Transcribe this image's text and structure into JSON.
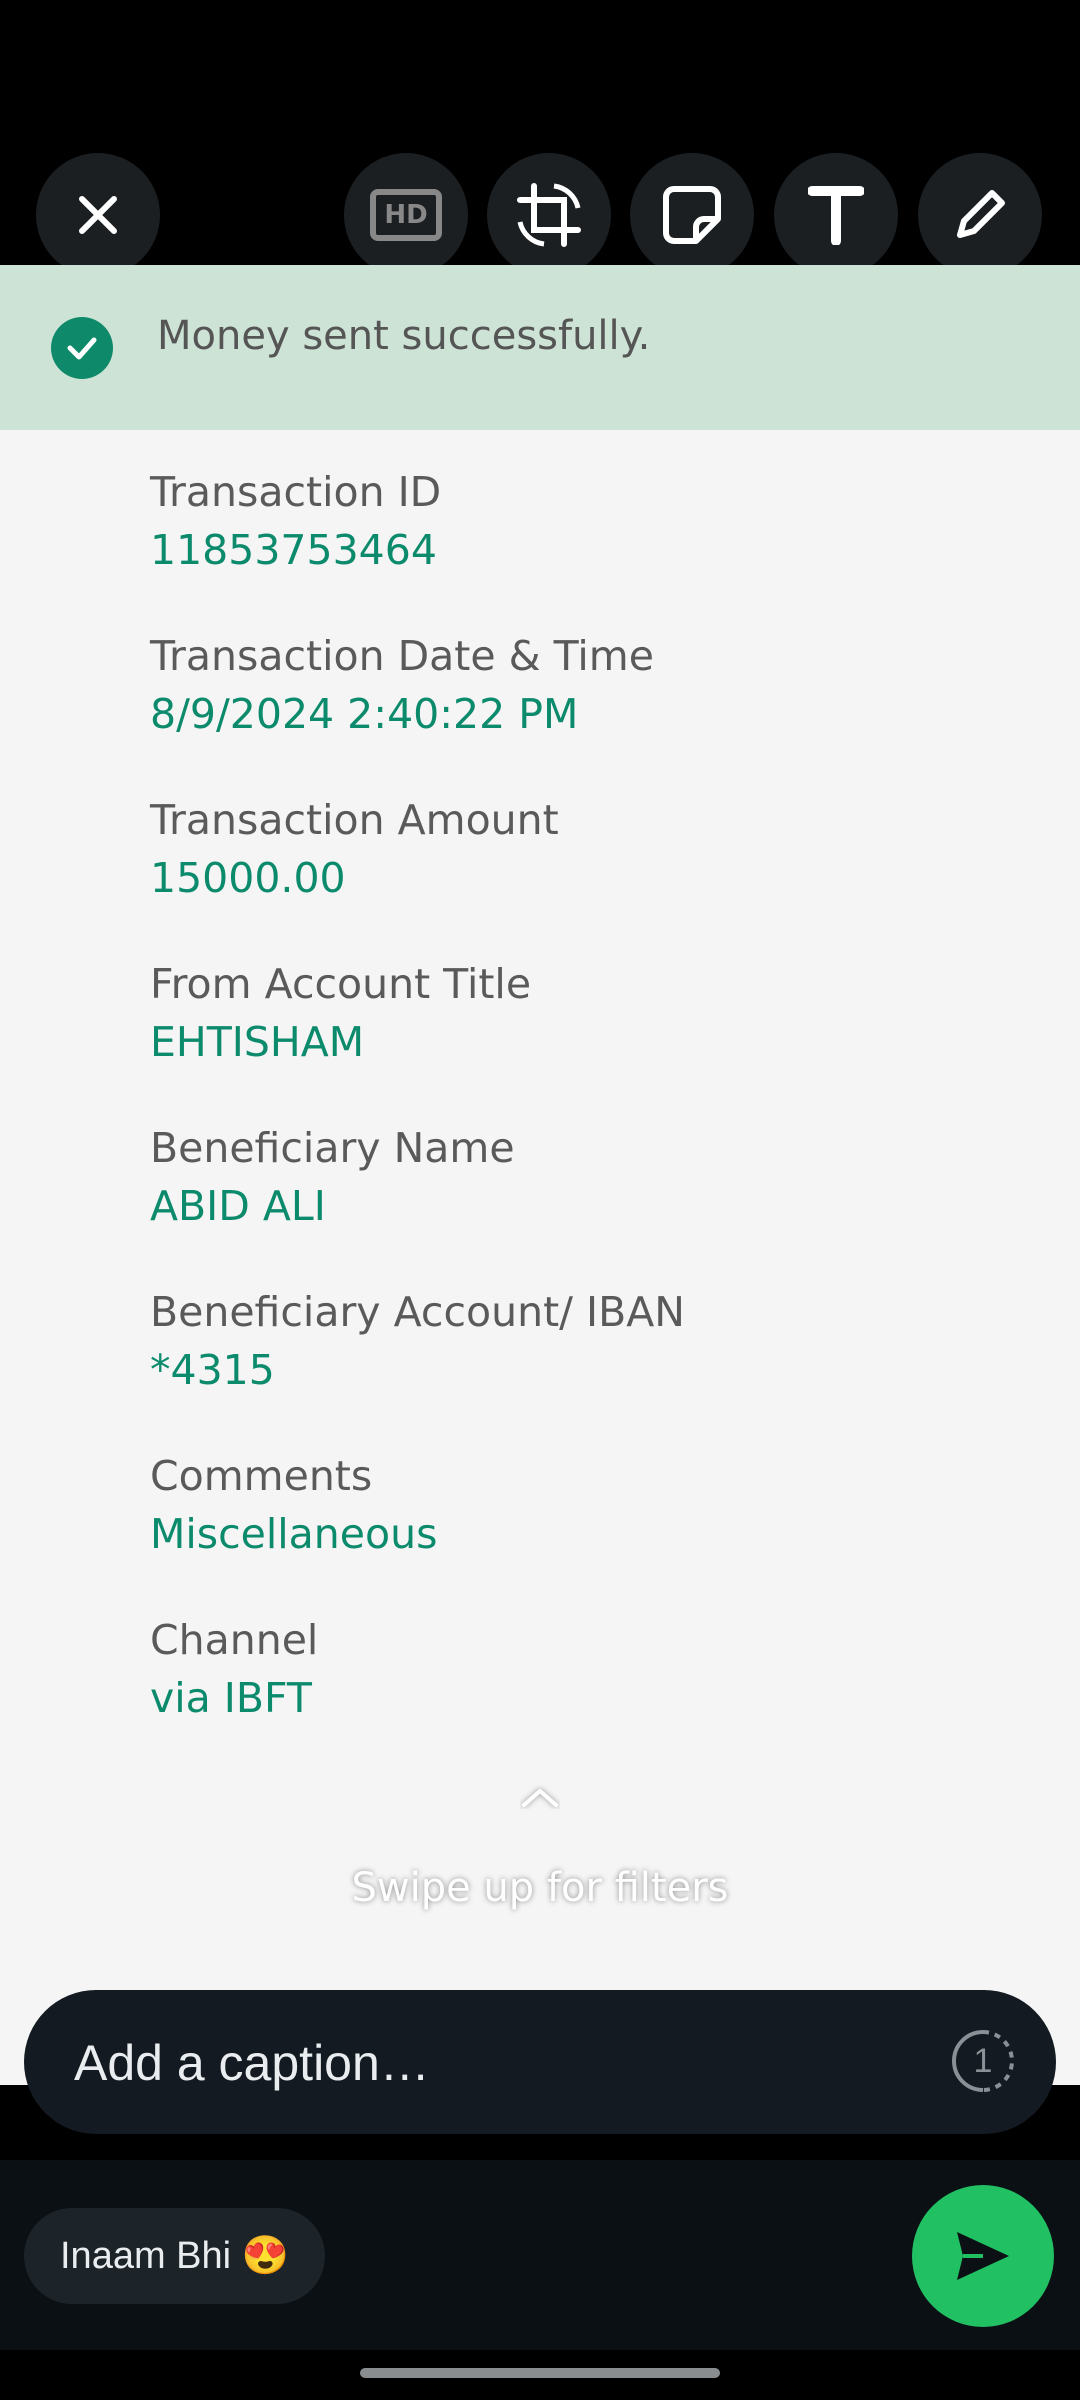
{
  "toolbar": {
    "close_icon": "close-icon",
    "hd_label": "HD",
    "crop_icon": "crop-rotate-icon",
    "sticker_icon": "sticker-icon",
    "text_icon": "text-icon",
    "draw_icon": "pencil-icon"
  },
  "banner": {
    "message": "Money sent successfully.",
    "icon": "check-circle-icon",
    "color": "#cde3d6"
  },
  "fields": [
    {
      "label": "Transaction ID",
      "value": "11853753464"
    },
    {
      "label": "Transaction Date & Time",
      "value": "8/9/2024 2:40:22 PM"
    },
    {
      "label": "Transaction Amount",
      "value": "15000.00"
    },
    {
      "label": "From Account Title",
      "value": "EHTISHAM"
    },
    {
      "label": "Beneficiary Name",
      "value": "ABID ALI"
    },
    {
      "label": "Beneficiary Account/ IBAN",
      "value": "*4315"
    },
    {
      "label": "Comments",
      "value": "Miscellaneous"
    },
    {
      "label": "Channel",
      "value": "via IBFT"
    }
  ],
  "filters_hint": "Swipe up for filters",
  "caption": {
    "placeholder": "Add a caption…",
    "view_once_label": "1"
  },
  "recipient": {
    "name": "Inaam Bhi 😍"
  },
  "colors": {
    "accent_green": "#0c8a6c",
    "send_green": "#21c063"
  }
}
